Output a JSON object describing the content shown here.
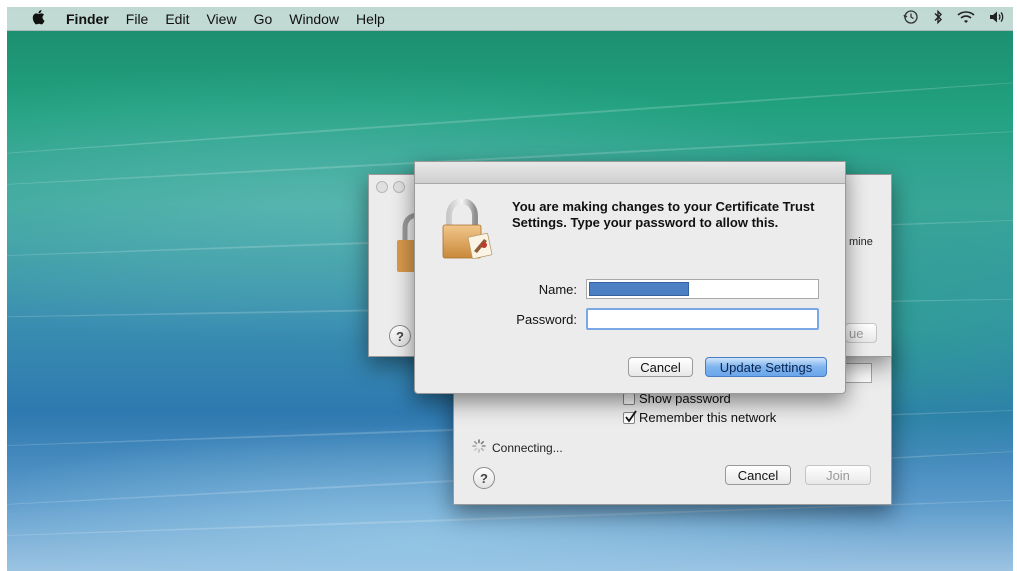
{
  "menubar": {
    "app_name": "Finder",
    "items": [
      "File",
      "Edit",
      "View",
      "Go",
      "Window",
      "Help"
    ],
    "status_icons": [
      "time-machine-icon",
      "bluetooth-icon",
      "wifi-icon",
      "volume-icon"
    ]
  },
  "back_sheet": {
    "partial_text": "mine",
    "partial_button": "ue"
  },
  "network_dialog": {
    "show_password_label": "Show password",
    "show_password_checked": false,
    "remember_label": "Remember this network",
    "remember_checked": true,
    "connecting_text": "Connecting...",
    "cancel_label": "Cancel",
    "join_label": "Join"
  },
  "auth_dialog": {
    "message": "You are making changes to your Certificate Trust Settings. Type your password to allow this.",
    "name_label": "Name:",
    "password_label": "Password:",
    "password_value": "",
    "cancel_label": "Cancel",
    "update_label": "Update Settings"
  }
}
